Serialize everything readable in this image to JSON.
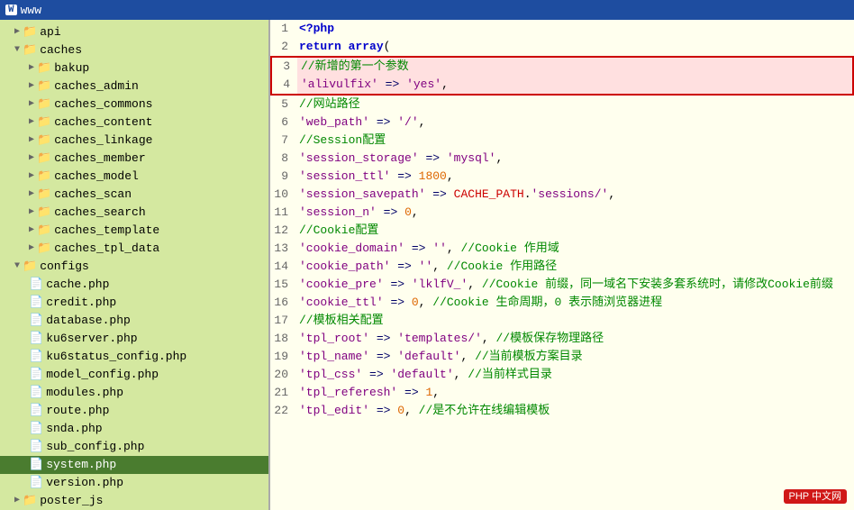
{
  "titleBar": {
    "icon": "W",
    "label": "www"
  },
  "tree": {
    "items": [
      {
        "id": "api",
        "label": "api",
        "type": "folder",
        "level": 1,
        "expanded": false
      },
      {
        "id": "caches",
        "label": "caches",
        "type": "folder",
        "level": 1,
        "expanded": true
      },
      {
        "id": "bakup",
        "label": "bakup",
        "type": "folder",
        "level": 2,
        "expanded": false
      },
      {
        "id": "caches_admin",
        "label": "caches_admin",
        "type": "folder",
        "level": 2,
        "expanded": false
      },
      {
        "id": "caches_commons",
        "label": "caches_commons",
        "type": "folder",
        "level": 2,
        "expanded": false
      },
      {
        "id": "caches_content",
        "label": "caches_content",
        "type": "folder",
        "level": 2,
        "expanded": false
      },
      {
        "id": "caches_linkage",
        "label": "caches_linkage",
        "type": "folder",
        "level": 2,
        "expanded": false
      },
      {
        "id": "caches_member",
        "label": "caches_member",
        "type": "folder",
        "level": 2,
        "expanded": false
      },
      {
        "id": "caches_model",
        "label": "caches_model",
        "type": "folder",
        "level": 2,
        "expanded": false
      },
      {
        "id": "caches_scan",
        "label": "caches_scan",
        "type": "folder",
        "level": 2,
        "expanded": false
      },
      {
        "id": "caches_search",
        "label": "caches_search",
        "type": "folder",
        "level": 2,
        "expanded": false
      },
      {
        "id": "caches_template",
        "label": "caches_template",
        "type": "folder",
        "level": 2,
        "expanded": false
      },
      {
        "id": "caches_tpl_data",
        "label": "caches_tpl_data",
        "type": "folder",
        "level": 2,
        "expanded": false
      },
      {
        "id": "configs",
        "label": "configs",
        "type": "folder",
        "level": 1,
        "expanded": true
      },
      {
        "id": "cache.php",
        "label": "cache.php",
        "type": "file",
        "level": 2
      },
      {
        "id": "credit.php",
        "label": "credit.php",
        "type": "file",
        "level": 2
      },
      {
        "id": "database.php",
        "label": "database.php",
        "type": "file",
        "level": 2
      },
      {
        "id": "ku6server.php",
        "label": "ku6server.php",
        "type": "file",
        "level": 2
      },
      {
        "id": "ku6status_config.php",
        "label": "ku6status_config.php",
        "type": "file",
        "level": 2
      },
      {
        "id": "model_config.php",
        "label": "model_config.php",
        "type": "file",
        "level": 2
      },
      {
        "id": "modules.php",
        "label": "modules.php",
        "type": "file",
        "level": 2
      },
      {
        "id": "route.php",
        "label": "route.php",
        "type": "file",
        "level": 2
      },
      {
        "id": "snda.php",
        "label": "snda.php",
        "type": "file",
        "level": 2
      },
      {
        "id": "sub_config.php",
        "label": "sub_config.php",
        "type": "file",
        "level": 2
      },
      {
        "id": "system.php",
        "label": "system.php",
        "type": "file",
        "level": 2,
        "selected": true
      },
      {
        "id": "version.php",
        "label": "version.php",
        "type": "file",
        "level": 2
      },
      {
        "id": "poster_js",
        "label": "poster_js",
        "type": "folder",
        "level": 1,
        "expanded": false
      }
    ]
  },
  "code": {
    "lines": [
      {
        "num": 1,
        "html": "<span class='kw-php'>&lt;?php</span>"
      },
      {
        "num": 2,
        "html": "<span class='kw-return'>return</span> <span class='kw-array'>array</span>("
      },
      {
        "num": 3,
        "html": "<span class='comment'>//新增的第一个参数</span>",
        "highlight": true,
        "highlightTop": true
      },
      {
        "num": 4,
        "html": "<span class='str'>'alivulfix'</span> <span class='arrow'>=&gt;</span> <span class='str'>'yes'</span>,",
        "highlight": true,
        "highlightBottom": true
      },
      {
        "num": 5,
        "html": "<span class='comment'>//网站路径</span>"
      },
      {
        "num": 6,
        "html": "<span class='str'>'web_path'</span> <span class='arrow'>=&gt;</span> <span class='str'>'/'</span>,"
      },
      {
        "num": 7,
        "html": "<span class='comment'>//Session配置</span>"
      },
      {
        "num": 8,
        "html": "<span class='str'>'session_storage'</span> <span class='arrow'>=&gt;</span> <span class='str'>'mysql'</span>,"
      },
      {
        "num": 9,
        "html": "<span class='str'>'session_ttl'</span> <span class='arrow'>=&gt;</span> <span class='number'>1800</span>,"
      },
      {
        "num": 10,
        "html": "<span class='str'>'session_savepath'</span> <span class='arrow'>=&gt;</span> <span class='constant'>CACHE_PATH</span>.<span class='str'>'sessions/'</span>,"
      },
      {
        "num": 11,
        "html": "<span class='str'>'session_n'</span> <span class='arrow'>=&gt;</span> <span class='number'>0</span>,"
      },
      {
        "num": 12,
        "html": "<span class='comment'>//Cookie配置</span>"
      },
      {
        "num": 13,
        "html": "<span class='str'>'cookie_domain'</span> <span class='arrow'>=&gt;</span> <span class='str'>''</span>, <span class='comment'>//Cookie 作用域</span>"
      },
      {
        "num": 14,
        "html": "<span class='str'>'cookie_path'</span> <span class='arrow'>=&gt;</span> <span class='str'>''</span>, <span class='comment'>//Cookie 作用路径</span>"
      },
      {
        "num": 15,
        "html": "<span class='str'>'cookie_pre'</span> <span class='arrow'>=&gt;</span> <span class='str'>'lklfV_'</span>, <span class='comment'>//Cookie 前缀，同一域名下安装多套系统时，请修改Cookie前缀</span>"
      },
      {
        "num": 16,
        "html": "<span class='str'>'cookie_ttl'</span> <span class='arrow'>=&gt;</span> <span class='number'>0</span>, <span class='comment'>//Cookie 生命周期，0 表示随浏览器进程</span>"
      },
      {
        "num": 17,
        "html": "<span class='comment'>//模板相关配置</span>"
      },
      {
        "num": 18,
        "html": "<span class='str'>'tpl_root'</span> <span class='arrow'>=&gt;</span> <span class='str'>'templates/'</span>, <span class='comment'>//模板保存物理路径</span>"
      },
      {
        "num": 19,
        "html": "<span class='str'>'tpl_name'</span> <span class='arrow'>=&gt;</span> <span class='str'>'default'</span>, <span class='comment'>//当前模板方案目录</span>"
      },
      {
        "num": 20,
        "html": "<span class='str'>'tpl_css'</span> <span class='arrow'>=&gt;</span> <span class='str'>'default'</span>, <span class='comment'>//当前样式目录</span>"
      },
      {
        "num": 21,
        "html": "<span class='str'>'tpl_referesh'</span> <span class='arrow'>=&gt;</span> <span class='number'>1</span>,"
      },
      {
        "num": 22,
        "html": "<span class='str'>'tpl_edit'</span> <span class='arrow'>=&gt;</span> <span class='number'>0</span>, <span class='comment'>//是不允许在线编辑模板</span>"
      }
    ]
  },
  "watermark": {
    "label": "PHP 中文网"
  }
}
